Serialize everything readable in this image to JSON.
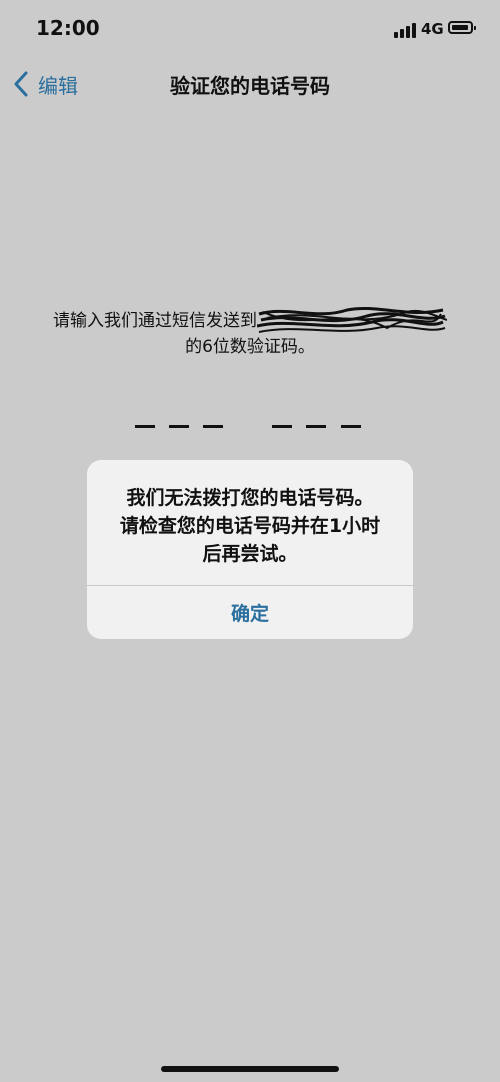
{
  "status_bar": {
    "time": "12:00",
    "network": "4G",
    "icons": [
      "signal-icon",
      "battery-icon"
    ]
  },
  "nav": {
    "back_label": "编辑",
    "title": "验证您的电话号码",
    "back_icon": "chevron-left-icon"
  },
  "instruction": {
    "line1": "请输入我们通过短信发送到",
    "line2": "的6位数验证码。"
  },
  "code_field": {
    "digits": 6
  },
  "alert": {
    "message_lines": [
      "我们无法拨打您的电话号码。",
      "请检查您的电话号码并在1小时",
      "后再尝试。"
    ],
    "confirm_label": "确定"
  },
  "colors": {
    "background": "#cbcbcb",
    "accent": "#2a6f9e",
    "alert_background": "#f1f1f1"
  }
}
